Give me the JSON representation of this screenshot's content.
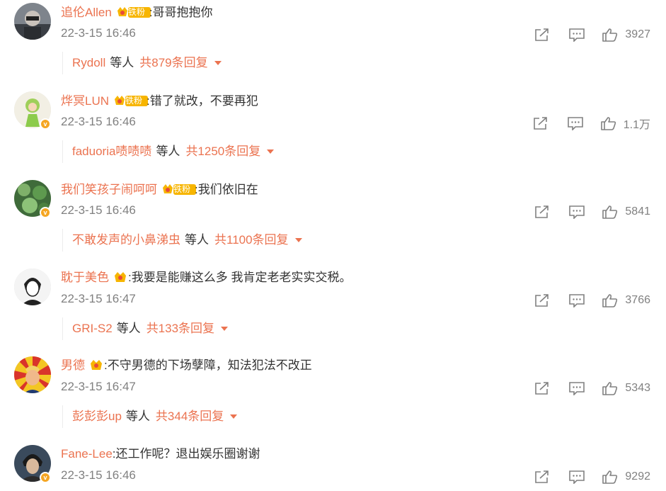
{
  "comments": [
    {
      "username": "追伦Allen",
      "badge": "铁粉",
      "text": ":哥哥抱抱你",
      "time": "22-3-15 16:46",
      "likes": "3927",
      "verified": false,
      "reply_user": "Rydoll",
      "reply_mid": "等人",
      "reply_count": "共879条回复"
    },
    {
      "username": "烨冥LUN",
      "badge": "铁粉",
      "text": ":错了就改，不要再犯",
      "time": "22-3-15 16:46",
      "likes": "1.1万",
      "verified": true,
      "reply_user": "faduoria啧啧啧",
      "reply_mid": "等人",
      "reply_count": "共1250条回复"
    },
    {
      "username": "我们笑孩子闹呵呵",
      "badge": "铁粉",
      "text": ":我们依旧在",
      "time": "22-3-15 16:46",
      "likes": "5841",
      "verified": true,
      "reply_user": "不敢发声的小鼻涕虫",
      "reply_mid": "等人",
      "reply_count": "共1100条回复"
    },
    {
      "username": "耽于美色",
      "badge": "",
      "text": ":我要是能赚这么多 我肯定老老实实交税。",
      "time": "22-3-15 16:47",
      "likes": "3766",
      "verified": false,
      "reply_user": "GRI-S2",
      "reply_mid": "等人",
      "reply_count": "共133条回复"
    },
    {
      "username": "男德",
      "badge": "",
      "text": ":不守男德的下场孽障，知法犯法不改正",
      "time": "22-3-15 16:47",
      "likes": "5343",
      "verified": false,
      "reply_user": "彭彭彭up",
      "reply_mid": "等人",
      "reply_count": "共344条回复"
    },
    {
      "username": "Fane-Lee",
      "badge": "",
      "text": ":还工作呢？退出娱乐圈谢谢",
      "time": "22-3-15 16:46",
      "likes": "9292",
      "verified": true
    }
  ],
  "icons": {
    "share": "share-icon",
    "comment": "comment-icon",
    "like": "thumbs-up-icon",
    "more": "caret-down-icon"
  },
  "colors": {
    "accent": "#eb7350",
    "muted": "#808080",
    "text": "#333333",
    "badge_gold": "#f5a623"
  }
}
